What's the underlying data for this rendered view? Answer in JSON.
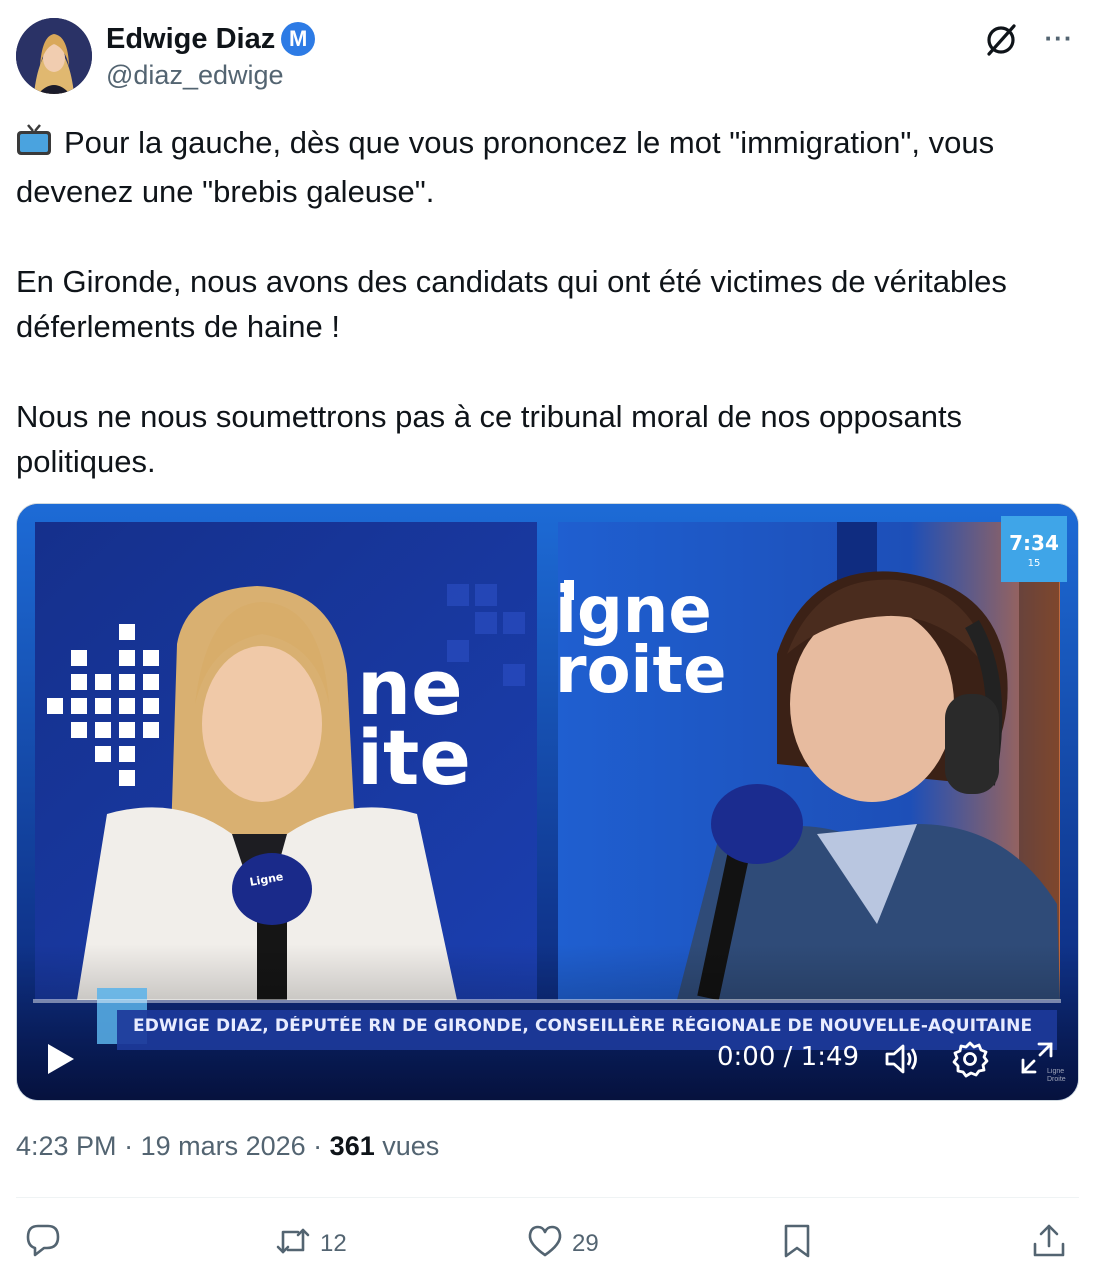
{
  "author": {
    "display_name": "Edwige Diaz",
    "verified_badge_letter": "M",
    "handle": "@diaz_edwige"
  },
  "icons": {
    "grok": "grok-icon",
    "more": "more-icon",
    "tv": "tv-icon",
    "play": "play-icon",
    "volume": "volume-icon",
    "settings": "gear-icon",
    "fullscreen": "expand-icon",
    "reply": "reply-icon",
    "retweet": "retweet-icon",
    "like": "heart-icon",
    "bookmark": "bookmark-icon",
    "share": "share-icon"
  },
  "more_label": "···",
  "tweet": {
    "paragraph1": "Pour la gauche, dès que vous prononcez le mot \"immigration\", vous devenez une \"brebis galeuse\".",
    "paragraph2": "En Gironde, nous avons des candidats qui ont été victimes de véritables déferlements de haine !",
    "paragraph3": "Nous ne nous soumettrons pas à ce tribunal moral de nos opposants politiques."
  },
  "video": {
    "left_logo": "ne\nite",
    "right_logo_line1": "igne",
    "right_logo_line2": "roite",
    "mic_logo": "Ligne\nDroite",
    "clock": "7:34",
    "clock_sub": "15",
    "lower_third": "EDWIGE DIAZ, DÉPUTÉE RN DE GIRONDE, CONSEILLÈRE RÉGIONALE DE NOUVELLE-AQUITAINE",
    "time_display": "0:00 / 1:49",
    "progress": 0,
    "watermark": "Ligne Droite"
  },
  "meta": {
    "time": "4:23 PM",
    "sep1": " · ",
    "date": "19 mars 2026",
    "sep2": " · ",
    "views_count": "361",
    "views_label": "vues"
  },
  "actions": {
    "replies": "",
    "retweets": "12",
    "likes": "29"
  },
  "colors": {
    "accent_badge": "#2d7be5",
    "video_blue": "#0d2a8c",
    "text_secondary": "#536471"
  }
}
